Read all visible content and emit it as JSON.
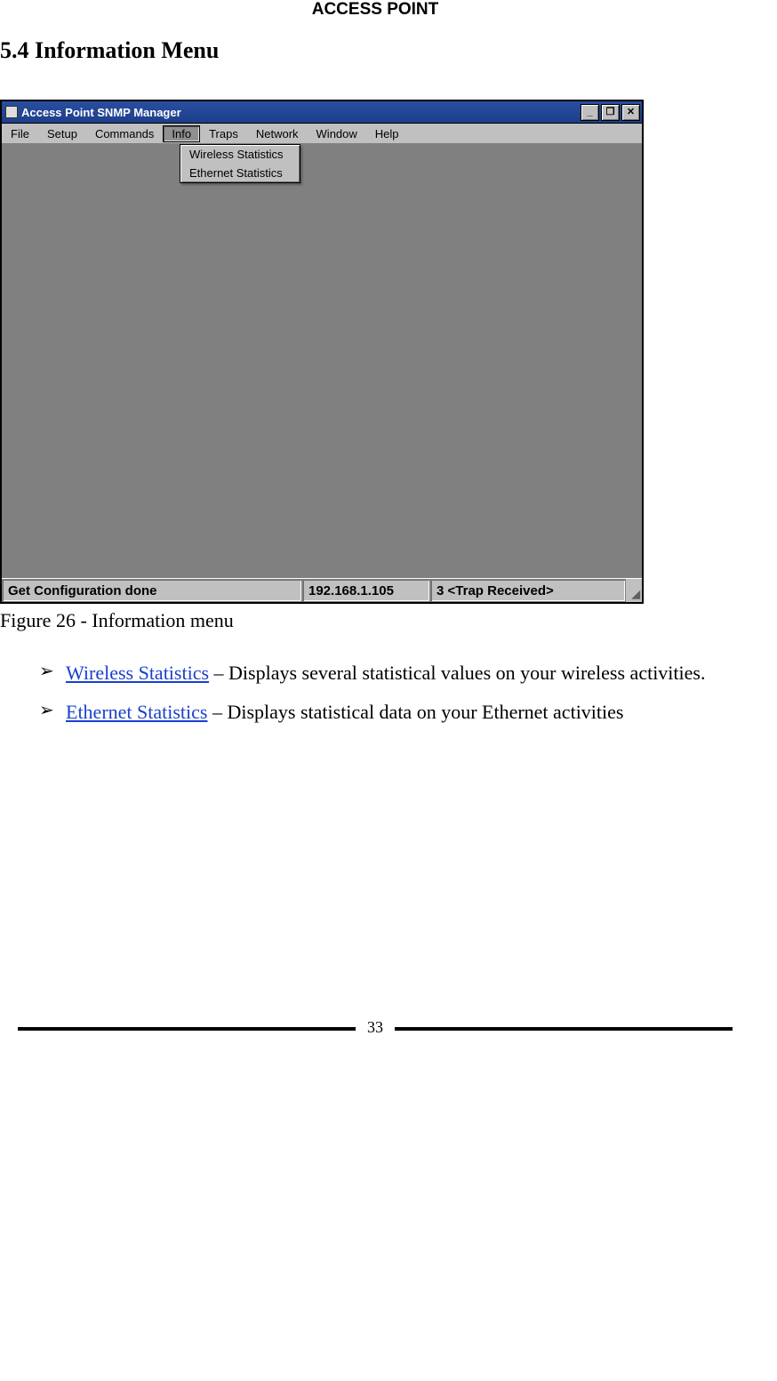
{
  "header": "ACCESS POINT",
  "section_heading": "5.4 Information Menu",
  "window": {
    "title": "Access Point SNMP Manager",
    "menu": [
      "File",
      "Setup",
      "Commands",
      "Info",
      "Traps",
      "Network",
      "Window",
      "Help"
    ],
    "active_menu_index": 3,
    "dropdown_items": [
      "Wireless Statistics",
      "Ethernet Statistics"
    ],
    "status": {
      "message": "Get Configuration done",
      "ip": "192.168.1.105",
      "trap": "3 <Trap Received>"
    },
    "sysbuttons": {
      "min": "_",
      "restore": "❐",
      "close": "✕"
    }
  },
  "caption": "Figure 26 - Information menu",
  "bullets": [
    {
      "link": "Wireless Statistics",
      "rest": " – Displays several statistical values on your wireless activities."
    },
    {
      "link": "Ethernet Statistics",
      "rest": " – Displays statistical data on your Ethernet activities"
    }
  ],
  "page_number": "33"
}
